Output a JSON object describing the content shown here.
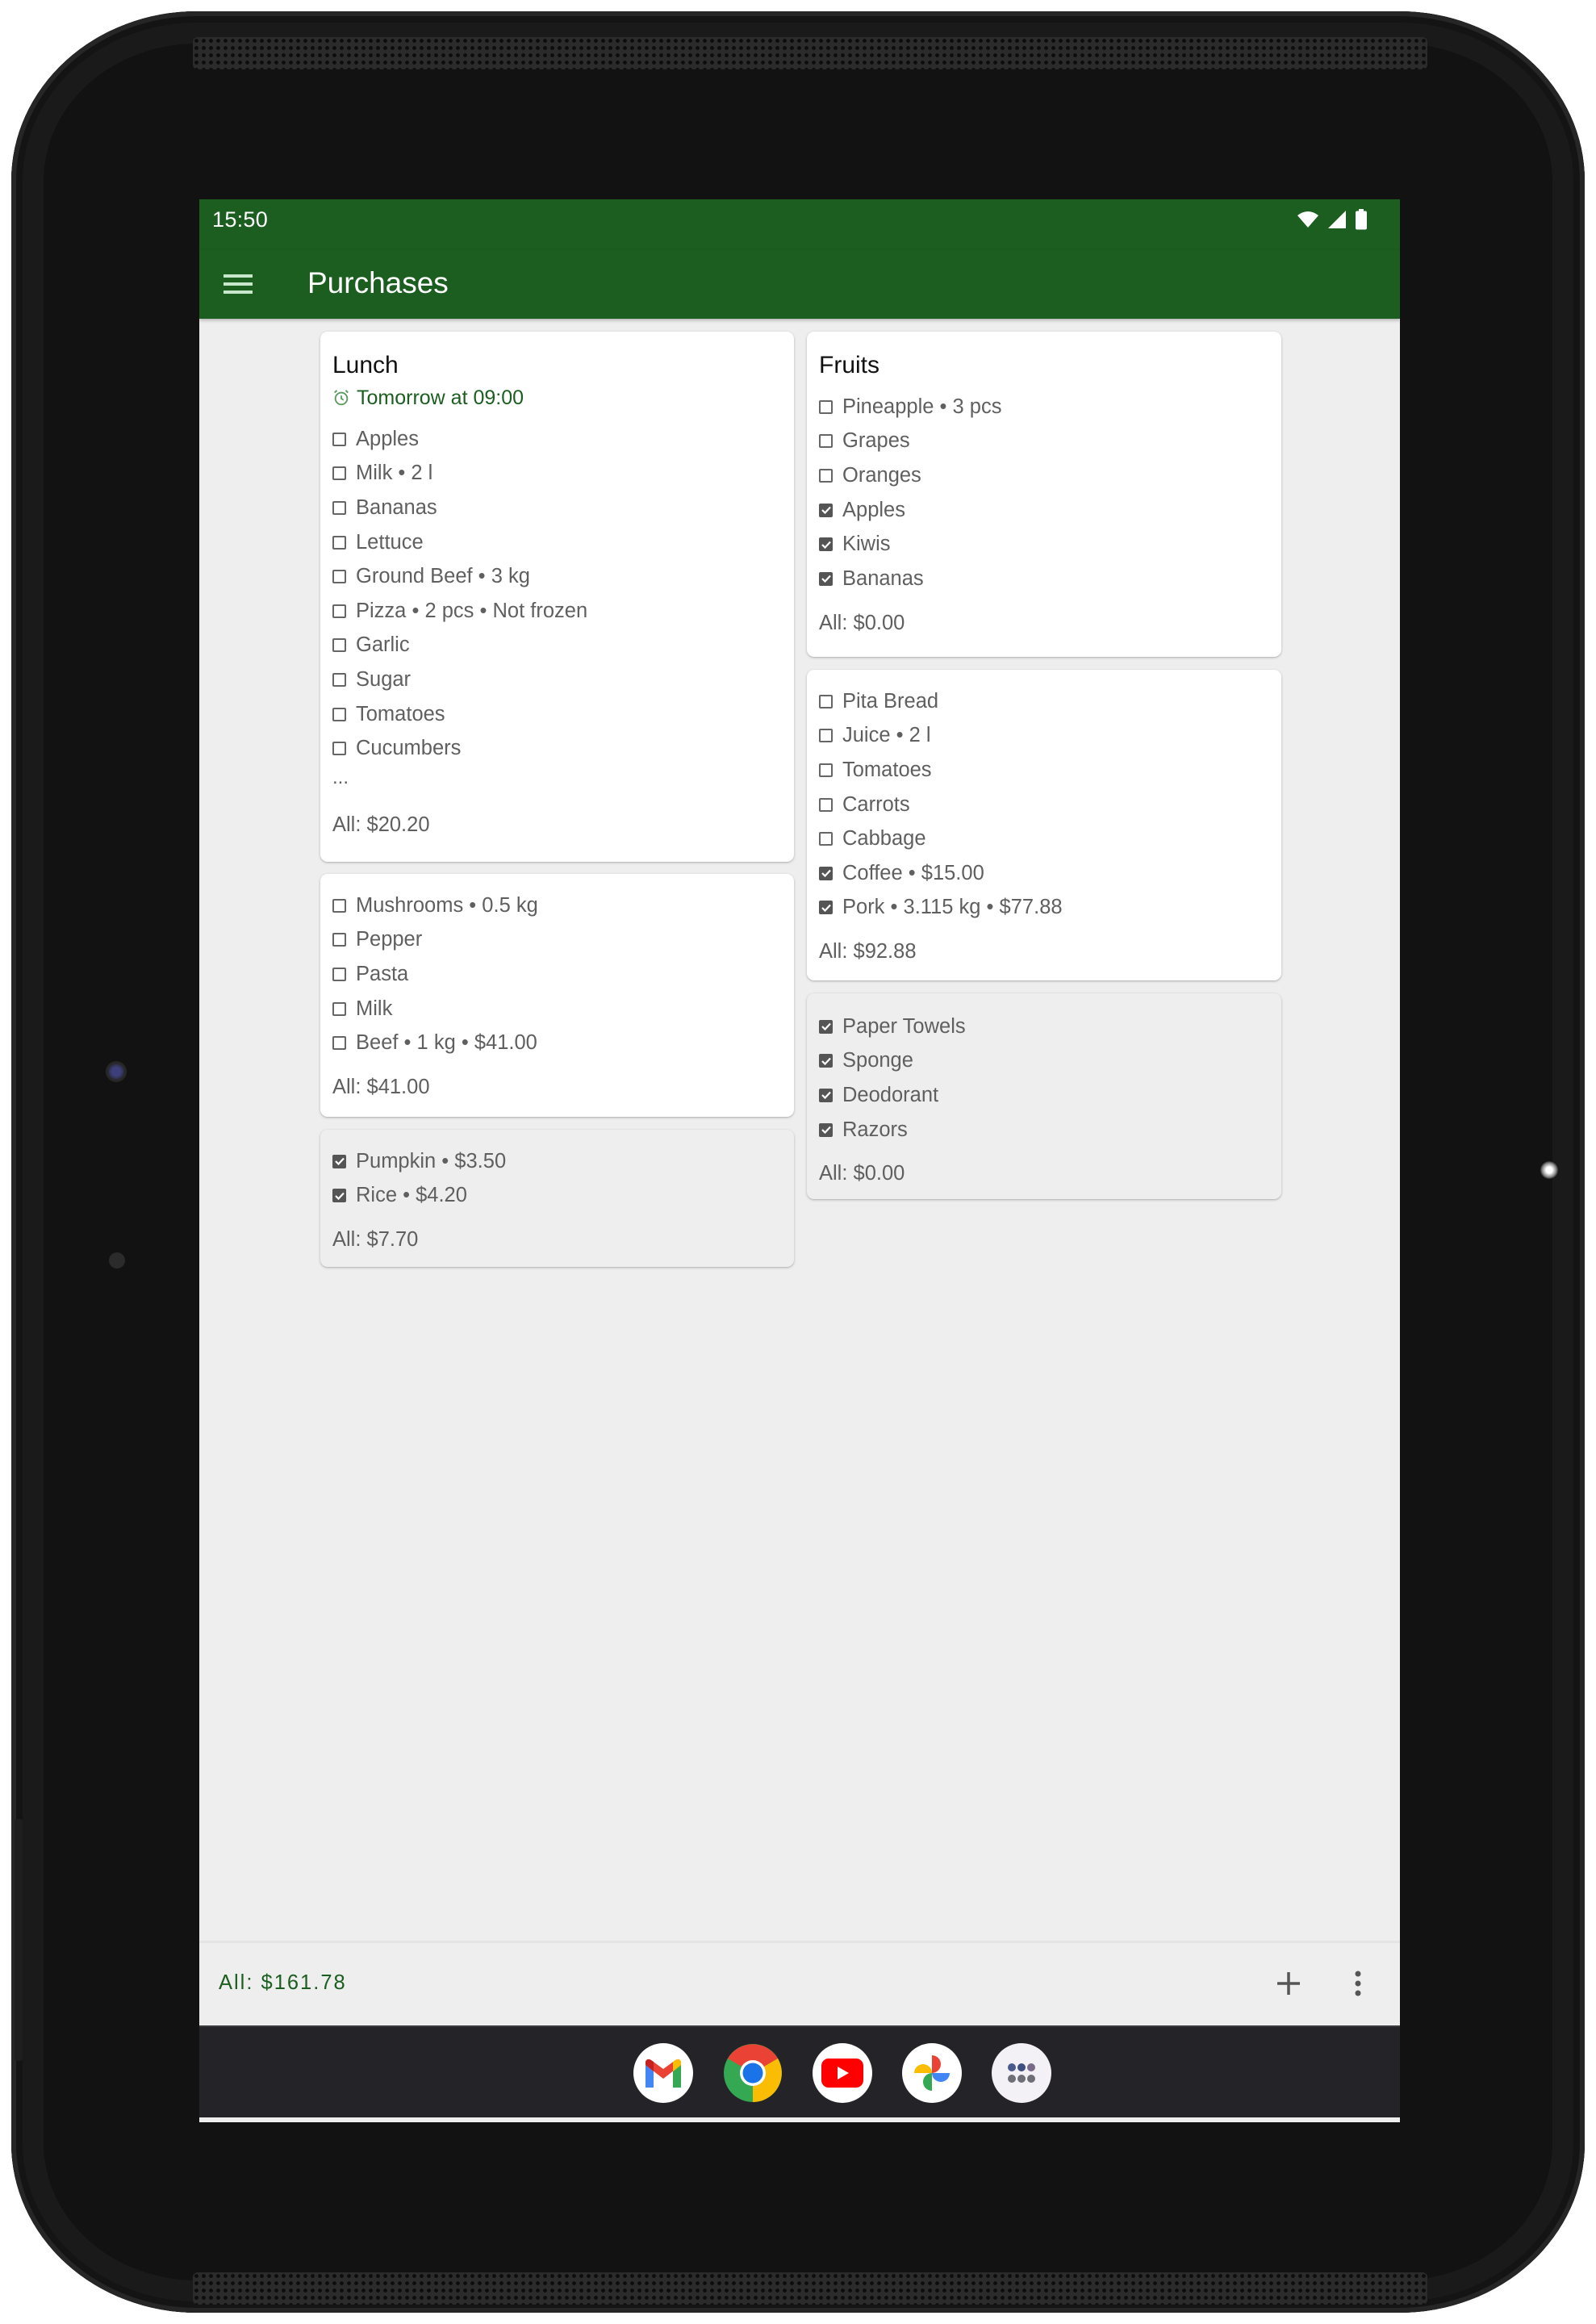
{
  "status_bar": {
    "time": "15:50",
    "icons": [
      "wifi-icon",
      "cellular-signal-icon",
      "battery-icon"
    ]
  },
  "app_bar": {
    "menu_icon": "hamburger-menu-icon",
    "title": "Purchases"
  },
  "colors": {
    "primary": "#1b5e20",
    "card_background": "#ffffff",
    "completed_card_background": "#eeeeee",
    "screen_background": "#eeeeee",
    "item_text": "#5f5f5f",
    "dock_background": "#242428"
  },
  "lists": [
    {
      "title": "Lunch",
      "reminder": "Tomorrow at 09:00",
      "reminder_icon": "alarm-clock-icon",
      "completed": false,
      "items": [
        {
          "label": "Apples",
          "checked": false
        },
        {
          "label": "Milk • 2 l",
          "checked": false
        },
        {
          "label": "Bananas",
          "checked": false
        },
        {
          "label": "Lettuce",
          "checked": false
        },
        {
          "label": "Ground Beef • 3 kg",
          "checked": false
        },
        {
          "label": "Pizza • 2 pcs • Not frozen",
          "checked": false
        },
        {
          "label": "Garlic",
          "checked": false
        },
        {
          "label": "Sugar",
          "checked": false
        },
        {
          "label": "Tomatoes",
          "checked": false
        },
        {
          "label": "Cucumbers",
          "checked": false
        }
      ],
      "more_indicator": "...",
      "total": "All: $20.20"
    },
    {
      "title": "",
      "completed": false,
      "items": [
        {
          "label": "Mushrooms • 0.5 kg",
          "checked": false
        },
        {
          "label": "Pepper",
          "checked": false
        },
        {
          "label": "Pasta",
          "checked": false
        },
        {
          "label": "Milk",
          "checked": false
        },
        {
          "label": "Beef • 1 kg • $41.00",
          "checked": false
        }
      ],
      "total": "All: $41.00"
    },
    {
      "title": "",
      "completed": true,
      "items": [
        {
          "label": "Pumpkin • $3.50",
          "checked": true
        },
        {
          "label": "Rice • $4.20",
          "checked": true
        }
      ],
      "total": "All: $7.70"
    },
    {
      "title": "Fruits",
      "completed": false,
      "items": [
        {
          "label": "Pineapple • 3 pcs",
          "checked": false
        },
        {
          "label": "Grapes",
          "checked": false
        },
        {
          "label": "Oranges",
          "checked": false
        },
        {
          "label": "Apples",
          "checked": true
        },
        {
          "label": "Kiwis",
          "checked": true
        },
        {
          "label": "Bananas",
          "checked": true
        }
      ],
      "total": "All: $0.00"
    },
    {
      "title": "",
      "completed": false,
      "items": [
        {
          "label": "Pita Bread",
          "checked": false
        },
        {
          "label": "Juice • 2 l",
          "checked": false
        },
        {
          "label": "Tomatoes",
          "checked": false
        },
        {
          "label": "Carrots",
          "checked": false
        },
        {
          "label": "Cabbage",
          "checked": false
        },
        {
          "label": "Coffee • $15.00",
          "checked": true
        },
        {
          "label": "Pork • 3.115 kg • $77.88",
          "checked": true
        }
      ],
      "total": "All: $92.88"
    },
    {
      "title": "",
      "completed": true,
      "items": [
        {
          "label": "Paper Towels",
          "checked": true
        },
        {
          "label": "Sponge",
          "checked": true
        },
        {
          "label": "Deodorant",
          "checked": true
        },
        {
          "label": "Razors",
          "checked": true
        }
      ],
      "total": "All: $0.00"
    }
  ],
  "bottom_bar": {
    "grand_total": "All: $161.78",
    "add_icon": "plus-icon",
    "more_icon": "more-vertical-icon"
  },
  "dock": {
    "apps": [
      {
        "name": "Gmail",
        "icon": "gmail-icon"
      },
      {
        "name": "Chrome",
        "icon": "chrome-icon"
      },
      {
        "name": "YouTube",
        "icon": "youtube-icon"
      },
      {
        "name": "Photos",
        "icon": "google-photos-icon"
      },
      {
        "name": "All apps",
        "icon": "app-drawer-icon"
      }
    ]
  }
}
